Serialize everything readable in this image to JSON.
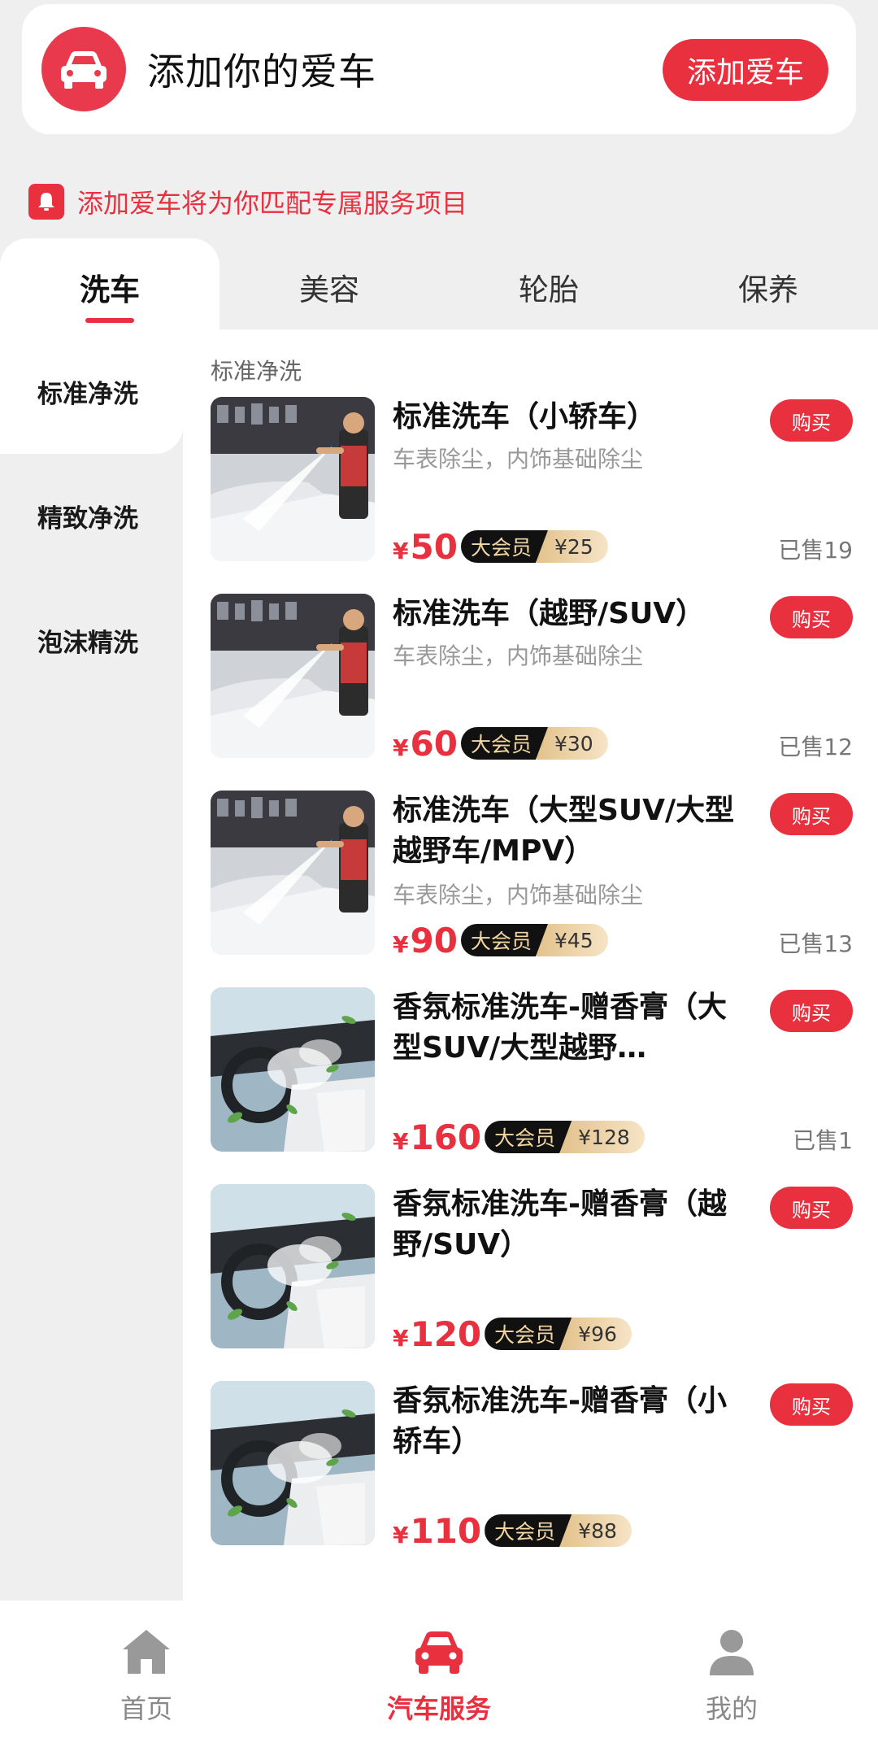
{
  "top_card": {
    "title": "添加你的爱车",
    "button_label": "添加爱车"
  },
  "notice": {
    "text": "添加爱车将为你匹配专属服务项目"
  },
  "tabs": [
    {
      "label": "洗车",
      "active": true
    },
    {
      "label": "美容",
      "active": false
    },
    {
      "label": "轮胎",
      "active": false
    },
    {
      "label": "保养",
      "active": false
    }
  ],
  "side_categories": [
    {
      "label": "标准净洗",
      "active": true
    },
    {
      "label": "精致净洗",
      "active": false
    },
    {
      "label": "泡沫精洗",
      "active": false
    }
  ],
  "section_label": "标准净洗",
  "currency": "¥",
  "vip_label": "大会员",
  "buy_label": "购买",
  "items": [
    {
      "title": "标准洗车（小轿车）",
      "desc": "车表除尘，内饰基础除尘",
      "price": "50",
      "vip_price": "¥25",
      "sold": "已售19",
      "image": "washing-photo"
    },
    {
      "title": "标准洗车（越野/SUV）",
      "desc": "车表除尘，内饰基础除尘",
      "price": "60",
      "vip_price": "¥30",
      "sold": "已售12",
      "image": "washing-photo"
    },
    {
      "title": "标准洗车（大型SUV/大型越野车/MPV）",
      "desc": "车表除尘，内饰基础除尘",
      "price": "90",
      "vip_price": "¥45",
      "sold": "已售13",
      "image": "washing-photo"
    },
    {
      "title": "香氛标准洗车-赠香膏（大型SUV/大型越野…",
      "desc": "",
      "price": "160",
      "vip_price": "¥128",
      "sold": "已售1",
      "image": "interior-photo"
    },
    {
      "title": "香氛标准洗车-赠香膏（越野/SUV）",
      "desc": "",
      "price": "120",
      "vip_price": "¥96",
      "sold": "",
      "image": "interior-photo"
    },
    {
      "title": "香氛标准洗车-赠香膏（小轿车）",
      "desc": "",
      "price": "110",
      "vip_price": "¥88",
      "sold": "",
      "image": "interior-photo"
    }
  ],
  "bottom_nav": [
    {
      "label": "首页",
      "icon": "home-icon",
      "active": false
    },
    {
      "label": "汽车服务",
      "icon": "car-icon",
      "active": true
    },
    {
      "label": "我的",
      "icon": "user-icon",
      "active": false
    }
  ],
  "colors": {
    "accent": "#e8303f",
    "vip_dark": "#111111",
    "vip_gold": "#e3c28c"
  }
}
